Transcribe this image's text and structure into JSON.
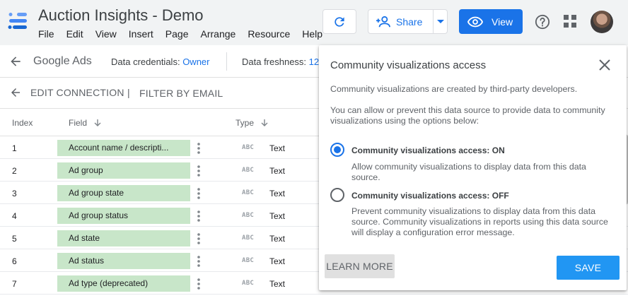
{
  "app": {
    "title": "Auction Insights - Demo",
    "menu": [
      "File",
      "Edit",
      "View",
      "Insert",
      "Page",
      "Arrange",
      "Resource",
      "Help"
    ],
    "share_label": "Share",
    "view_label": "View",
    "colors": {
      "accent": "#1a73e8",
      "chip_green": "#c8e6c9",
      "save_blue": "#2196f3"
    }
  },
  "datasource": {
    "name": "Google Ads",
    "credentials_label": "Data credentials:",
    "credentials_value": "Owner",
    "freshness_label": "Data freshness:",
    "freshness_value": "12"
  },
  "actions": {
    "edit_connection": "EDIT CONNECTION",
    "separator": "|",
    "filter_by_email": "FILTER BY EMAIL"
  },
  "table": {
    "columns": {
      "index": "Index",
      "field": "Field",
      "type": "Type"
    },
    "rows": [
      {
        "index": "1",
        "field": "Account name / descripti...",
        "type_icon": "ABC",
        "type": "Text"
      },
      {
        "index": "2",
        "field": "Ad group",
        "type_icon": "ABC",
        "type": "Text"
      },
      {
        "index": "3",
        "field": "Ad group state",
        "type_icon": "ABC",
        "type": "Text"
      },
      {
        "index": "4",
        "field": "Ad group status",
        "type_icon": "ABC",
        "type": "Text"
      },
      {
        "index": "5",
        "field": "Ad state",
        "type_icon": "ABC",
        "type": "Text"
      },
      {
        "index": "6",
        "field": "Ad status",
        "type_icon": "ABC",
        "type": "Text"
      },
      {
        "index": "7",
        "field": "Ad type (deprecated)",
        "type_icon": "ABC",
        "type": "Text"
      }
    ]
  },
  "dialog": {
    "title": "Community visualizations access",
    "intro": "Community visualizations are created by third-party developers.",
    "instructions": "You can allow or prevent this data source to provide data to community visualizations using the options below:",
    "options": [
      {
        "title": "Community visualizations access: ON",
        "description": "Allow community visualizations to display data from this data source.",
        "selected": true
      },
      {
        "title": "Community visualizations access: OFF",
        "description": "Prevent community visualizations to display data from this data source. Community visualizations in reports using this data source will display a configuration error message.",
        "selected": false
      }
    ],
    "learn_more_label": "LEARN MORE",
    "save_label": "SAVE"
  }
}
